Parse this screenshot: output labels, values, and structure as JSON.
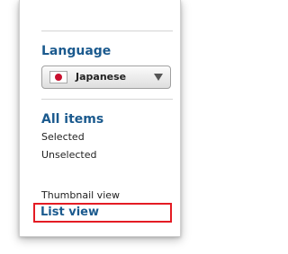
{
  "language_section": {
    "title": "Language",
    "selected_language": "Japanese",
    "flag_icon": "japan-flag-icon",
    "dropdown_icon": "chevron-down-icon"
  },
  "items_section": {
    "title": "All items",
    "filters": [
      "Selected",
      "Unselected"
    ]
  },
  "view_section": {
    "thumbnail_label": "Thumbnail view",
    "list_label": "List view",
    "highlight_color": "#e41b23"
  },
  "colors": {
    "heading": "#1b5a8e",
    "text": "#222222",
    "flag_red": "#c8102e"
  }
}
